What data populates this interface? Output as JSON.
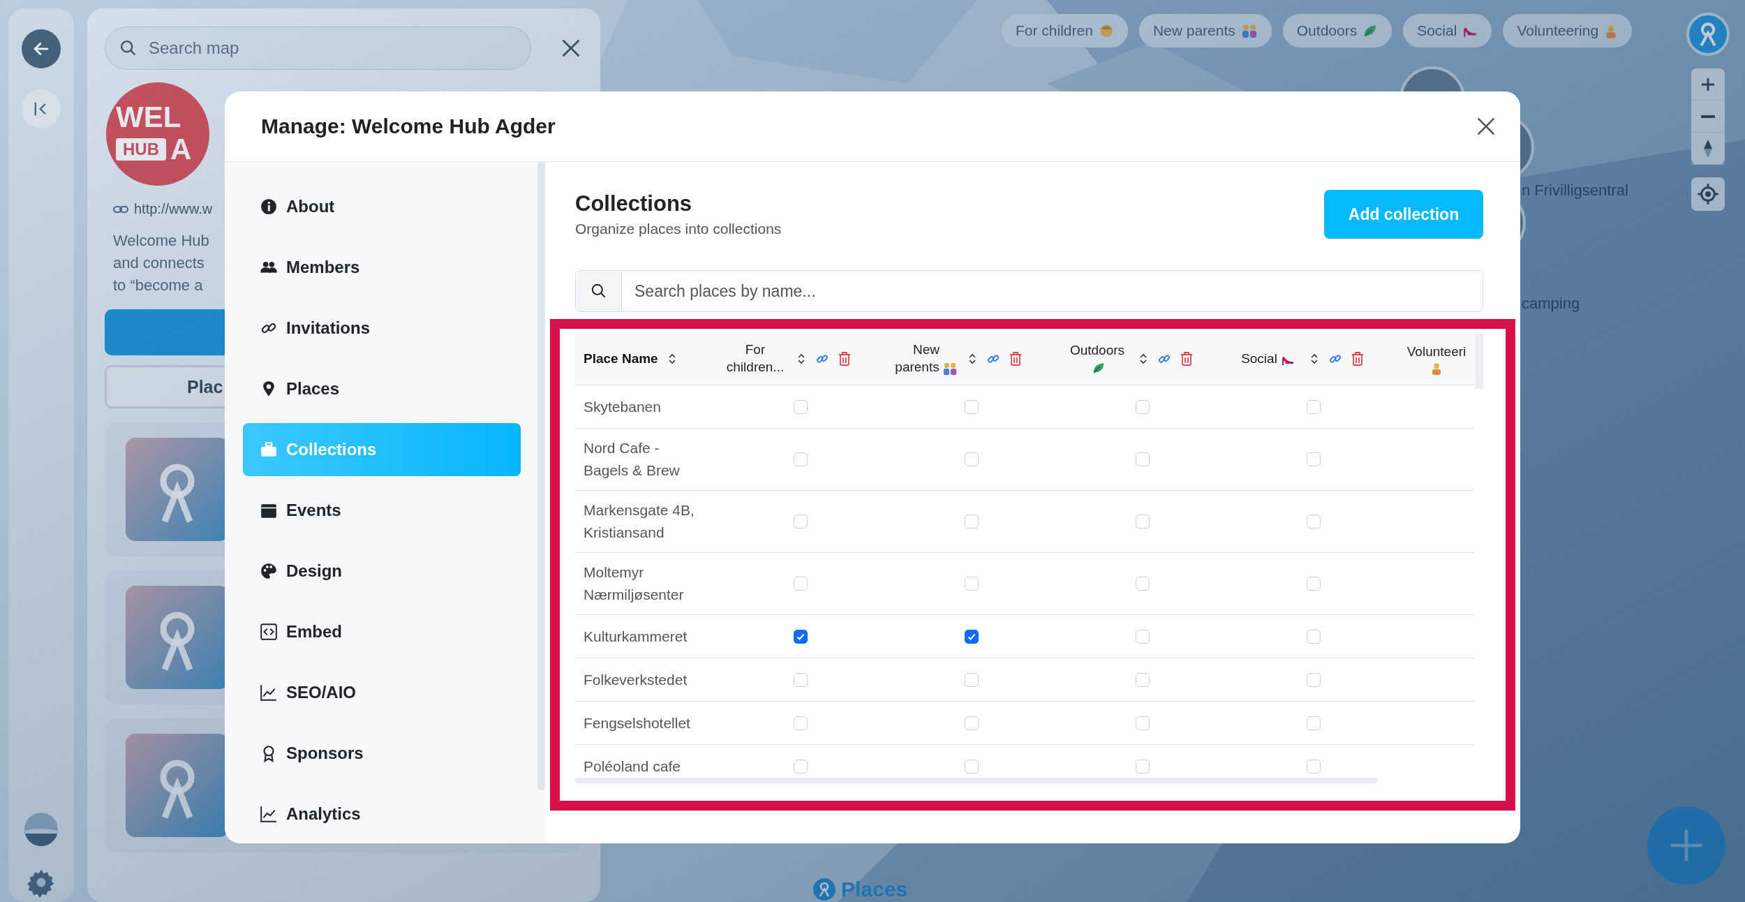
{
  "map_chips": [
    {
      "label": "For children",
      "kind": "child"
    },
    {
      "label": "New parents",
      "kind": "couple"
    },
    {
      "label": "Outdoors",
      "kind": "plant"
    },
    {
      "label": "Social",
      "kind": "shoe"
    },
    {
      "label": "Volunteering",
      "kind": "worker"
    }
  ],
  "map_markers": [
    {
      "label": "n Frivilligsentral"
    },
    {
      "label": "camping"
    }
  ],
  "places_tab": {
    "label": "Places"
  },
  "side_panel": {
    "search": {
      "placeholder": "Search map"
    },
    "logo": {
      "top": "WEL",
      "tag": "HUB",
      "side": "A"
    },
    "link": "http://www.w",
    "description": [
      "Welcome Hub",
      "and connects",
      "to “become a"
    ],
    "tab": "Plac",
    "cards": [
      {
        "kind": "placeholder"
      },
      {
        "kind": "placeholder"
      },
      {
        "kind": "placeholder"
      }
    ]
  },
  "modal": {
    "title": "Manage: Welcome Hub Agder",
    "nav": [
      {
        "label": "About",
        "kind": "info",
        "selected": false
      },
      {
        "label": "Members",
        "kind": "users",
        "selected": false
      },
      {
        "label": "Invitations",
        "kind": "link",
        "selected": false
      },
      {
        "label": "Places",
        "kind": "pin",
        "selected": false
      },
      {
        "label": "Collections",
        "kind": "case",
        "selected": true
      },
      {
        "label": "Events",
        "kind": "calendar",
        "selected": false
      },
      {
        "label": "Design",
        "kind": "palette",
        "selected": false
      },
      {
        "label": "Embed",
        "kind": "code",
        "selected": false
      },
      {
        "label": "SEO/AIO",
        "kind": "chart",
        "selected": false
      },
      {
        "label": "Sponsors",
        "kind": "award",
        "selected": false
      },
      {
        "label": "Analytics",
        "kind": "chart",
        "selected": false
      }
    ],
    "section": {
      "title": "Collections",
      "subtitle": "Organize places into collections",
      "add_button": "Add collection",
      "search": {
        "placeholder": "Search places by name..."
      }
    },
    "table": {
      "place_column": "Place Name",
      "collections": [
        {
          "label": "For children...",
          "kind": "none"
        },
        {
          "label": "New parents",
          "kind": "couple"
        },
        {
          "label": "Outdoors",
          "kind": "plant"
        },
        {
          "label": "Social",
          "kind": "shoe"
        }
      ],
      "cut_column": {
        "label": "Volunteeri",
        "kind": "worker"
      },
      "rows": [
        {
          "name": "Skytebanen",
          "checks": [
            {
              "checked": false
            },
            {
              "checked": false
            },
            {
              "checked": false
            },
            {
              "checked": false
            }
          ]
        },
        {
          "name": "Nord Cafe - Bagels & Brew",
          "checks": [
            {
              "checked": false
            },
            {
              "checked": false
            },
            {
              "checked": false
            },
            {
              "checked": false
            }
          ]
        },
        {
          "name": "Markensgate 4B, Kristiansand",
          "checks": [
            {
              "checked": false
            },
            {
              "checked": false
            },
            {
              "checked": false
            },
            {
              "checked": false
            }
          ]
        },
        {
          "name": "Moltemyr Nærmiljøsenter",
          "checks": [
            {
              "checked": false
            },
            {
              "checked": false
            },
            {
              "checked": false
            },
            {
              "checked": false
            }
          ]
        },
        {
          "name": "Kulturkammeret",
          "checks": [
            {
              "checked": true
            },
            {
              "checked": true
            },
            {
              "checked": false
            },
            {
              "checked": false
            }
          ]
        },
        {
          "name": "Folkeverkstedet",
          "checks": [
            {
              "checked": false
            },
            {
              "checked": false
            },
            {
              "checked": false
            },
            {
              "checked": false
            }
          ]
        },
        {
          "name": "Fengselshotellet",
          "checks": [
            {
              "checked": false
            },
            {
              "checked": false
            },
            {
              "checked": false
            },
            {
              "checked": false
            }
          ]
        },
        {
          "name": "Poléoland cafe",
          "checks": [
            {
              "checked": false
            },
            {
              "checked": false
            },
            {
              "checked": false
            },
            {
              "checked": false
            }
          ]
        }
      ]
    }
  }
}
